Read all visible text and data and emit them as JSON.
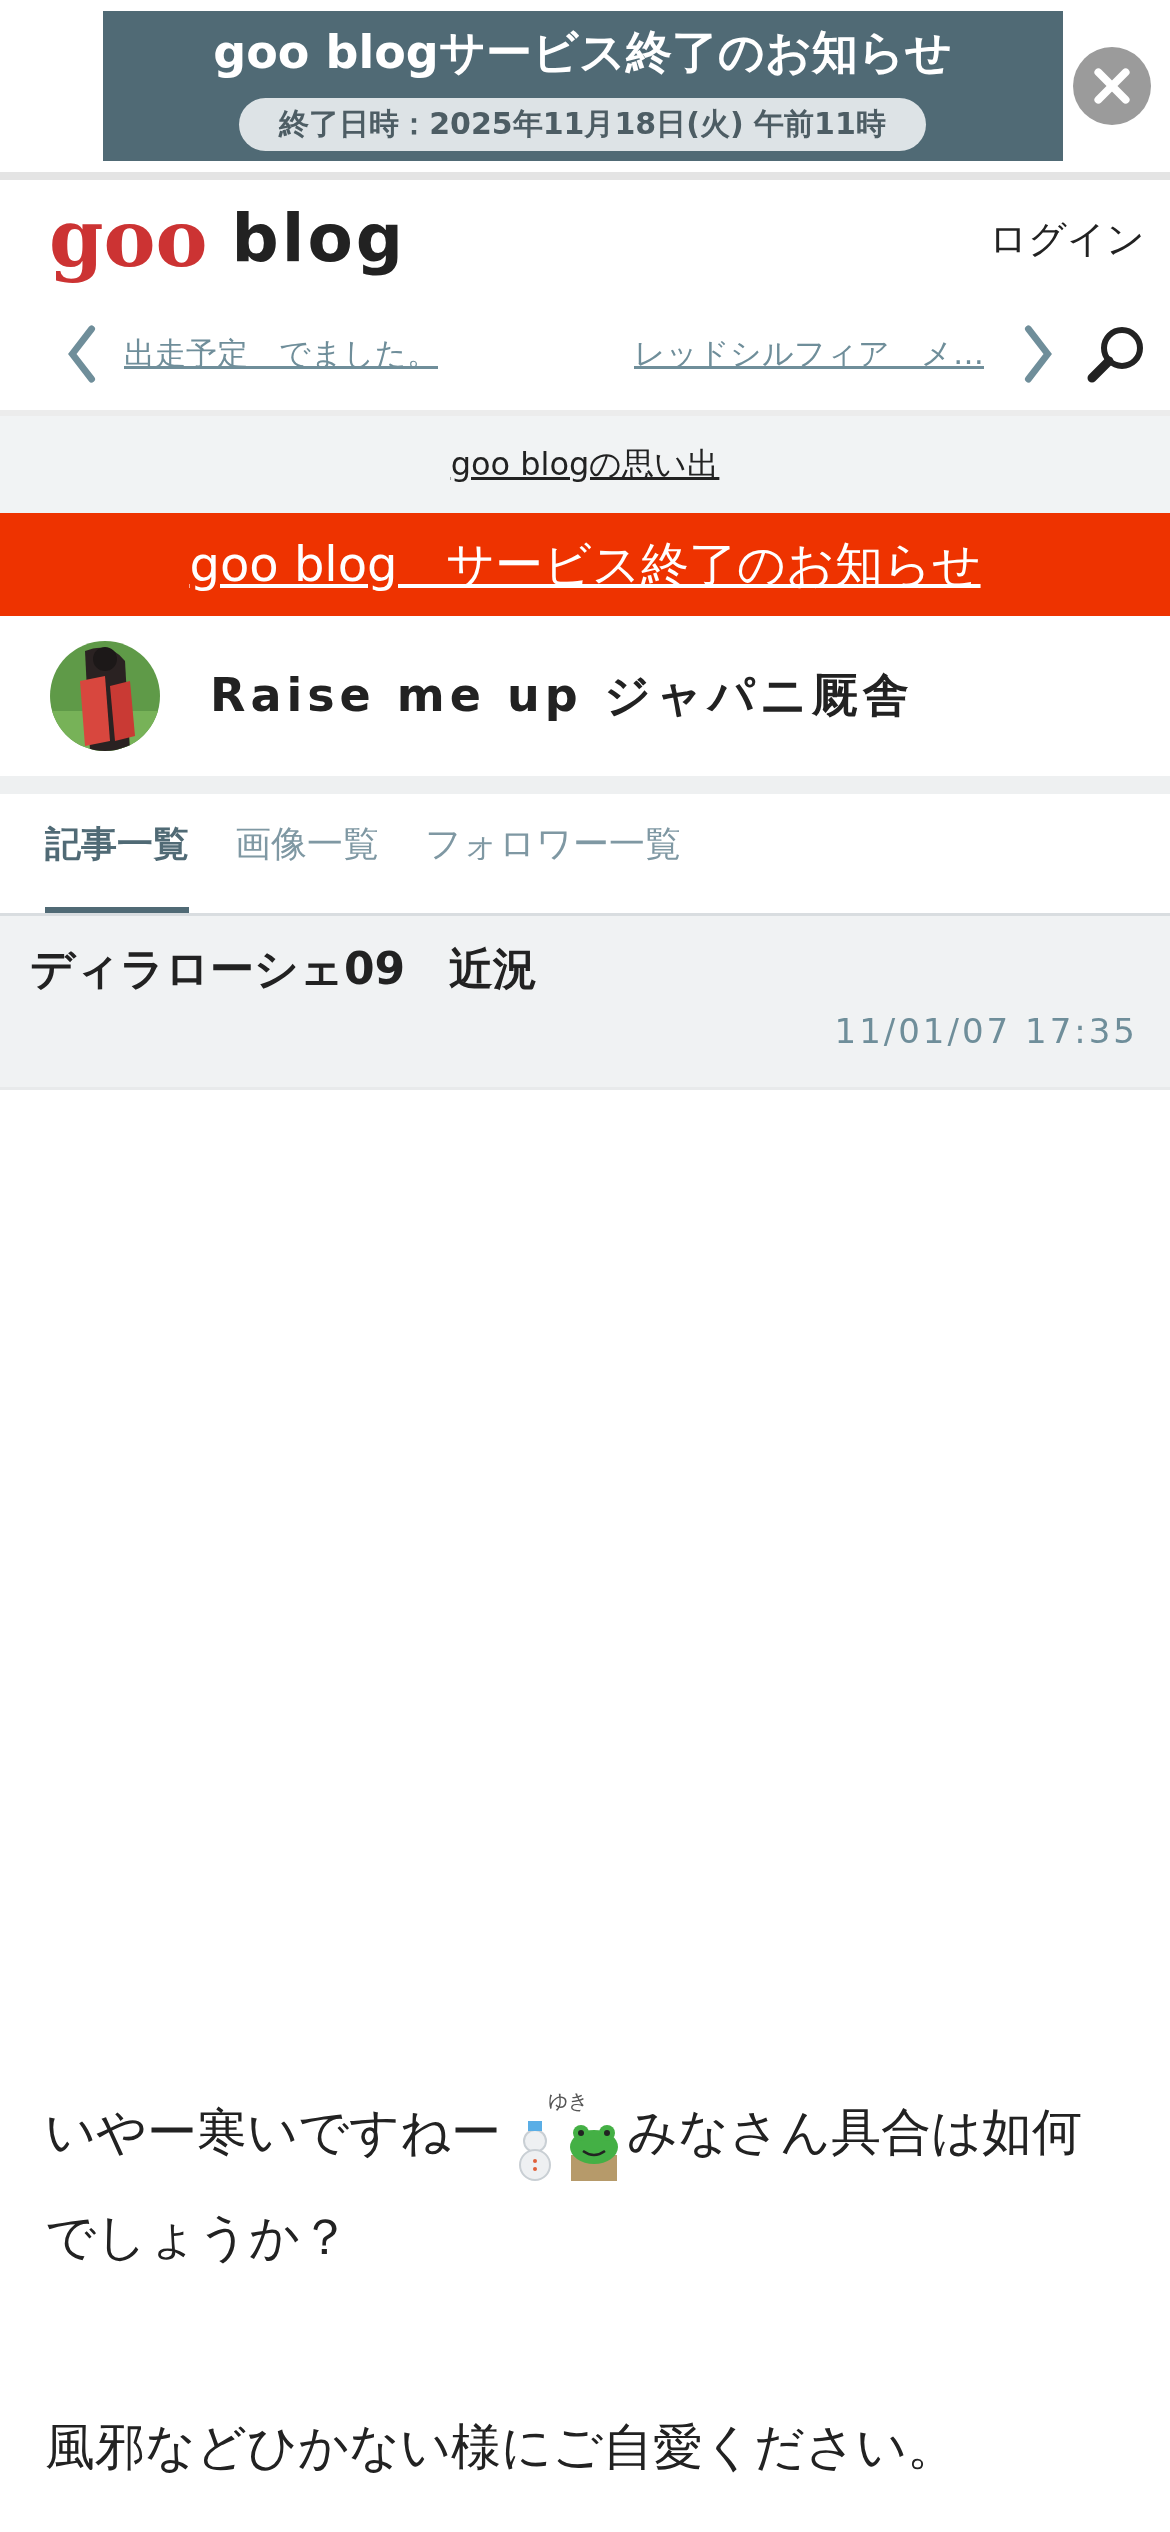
{
  "ad_banner": {
    "title": "goo blogサービス終了のお知らせ",
    "subtitle": "終了日時：2025年11月18日(火) 午前11時"
  },
  "header": {
    "logo_mark": "goo",
    "logo_text": "blog",
    "login": "ログイン"
  },
  "article_nav": {
    "previous": "出走予定　でました。",
    "next": "レッドシルフィア　メ…"
  },
  "memories_link": "goo blogの思い出",
  "notice_link": "goo blog　サービス終了のお知らせ",
  "blog": {
    "title": "Raise me up ジャパニ厩舎"
  },
  "tabs": [
    {
      "label": "記事一覧",
      "selected": true
    },
    {
      "label": "画像一覧",
      "selected": false
    },
    {
      "label": "フォロワー一覧",
      "selected": false
    }
  ],
  "post": {
    "title": "ディラローシェ09　近況",
    "date": "11/01/07 17:35",
    "body": [
      {
        "kind": "sticker_text",
        "before": "いやー寒いですねー",
        "sticker_caption": "ゆき",
        "after": "みなさん具合は如何でしょうか？"
      },
      {
        "kind": "gap"
      },
      {
        "kind": "text",
        "text": "風邪などひかない様にご自愛ください。"
      }
    ]
  }
}
